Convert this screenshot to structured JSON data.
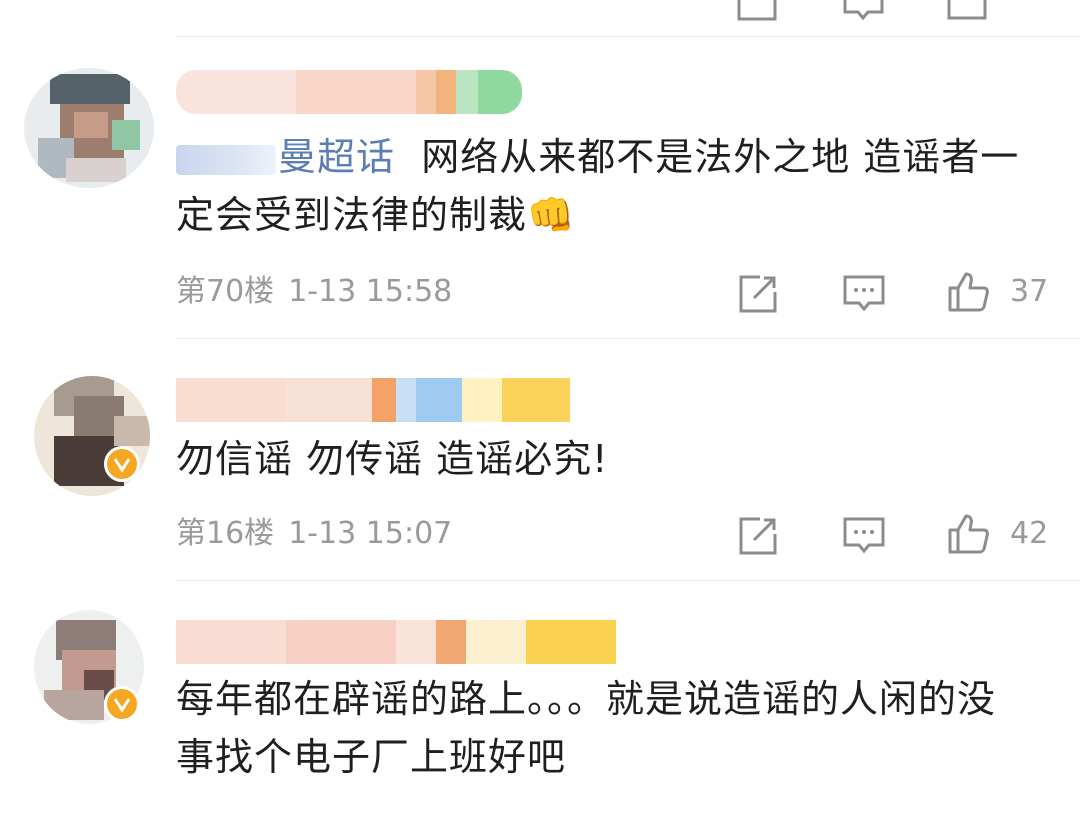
{
  "comments": [
    {
      "topic": "曼超话",
      "text": "网络从来都不是法外之地 造谣者一定会受到法律的制裁",
      "emoji": "👊",
      "floor": "第70楼",
      "time": "1-13 15:58",
      "likes": "37",
      "verified": false
    },
    {
      "text": "勿信谣 勿传谣 造谣必究!",
      "floor": "第16楼",
      "time": "1-13 15:07",
      "likes": "42",
      "verified": true
    },
    {
      "text": "每年都在辟谣的路上。。。就是说造谣的人闲的没事找个电子厂上班好吧",
      "verified": true
    }
  ],
  "icons": {
    "share": "share-icon",
    "reply": "comment-icon",
    "like": "thumbs-up-icon",
    "badge": "verified-badge-icon"
  },
  "colors": {
    "topic": "#5b7fb4",
    "meta": "#9a9a9a",
    "badge": "#f5a623"
  }
}
